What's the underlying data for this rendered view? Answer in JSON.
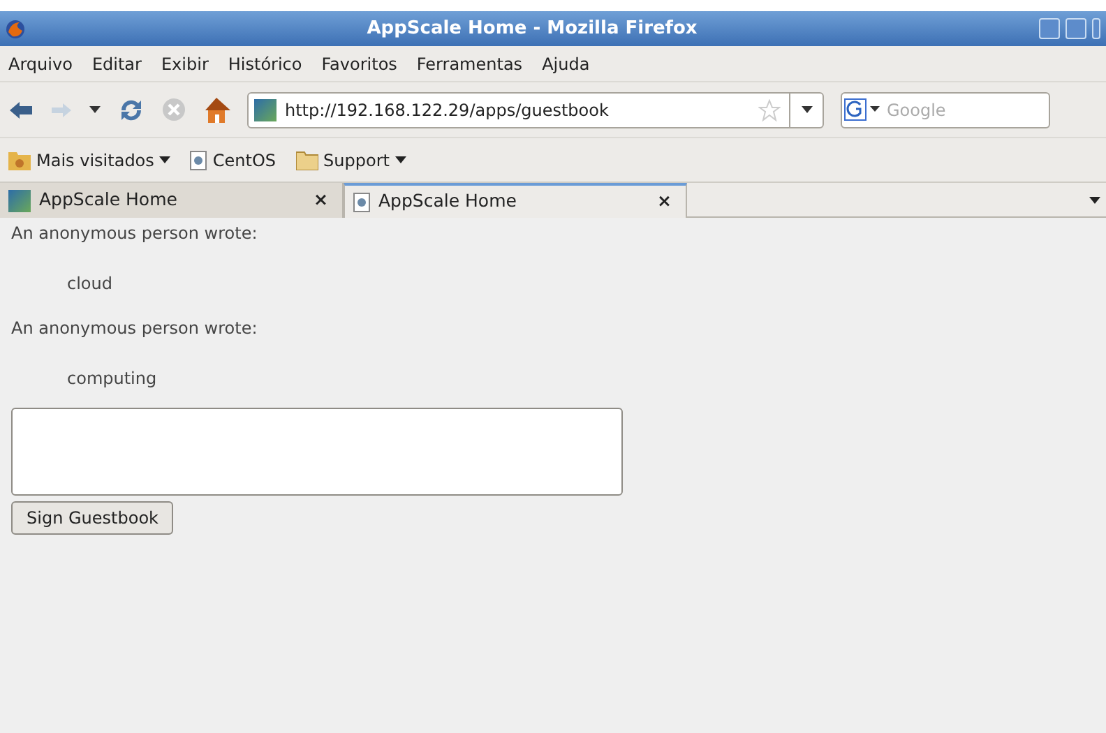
{
  "window": {
    "title": "AppScale Home - Mozilla Firefox"
  },
  "menu": [
    "Arquivo",
    "Editar",
    "Exibir",
    "Histórico",
    "Favoritos",
    "Ferramentas",
    "Ajuda"
  ],
  "address_bar": {
    "value": "http://192.168.122.29/apps/guestbook"
  },
  "search": {
    "placeholder": "Google"
  },
  "bookmarks": [
    {
      "label": "Mais visitados",
      "kind": "smart-folder",
      "dropdown": true
    },
    {
      "label": "CentOS",
      "kind": "page",
      "dropdown": false
    },
    {
      "label": "Support",
      "kind": "folder",
      "dropdown": true
    }
  ],
  "tabs": [
    {
      "label": "AppScale Home",
      "selected": false,
      "kind": "appscale"
    },
    {
      "label": "AppScale Home",
      "selected": true,
      "kind": "page"
    }
  ],
  "close_glyph": "×",
  "entries": [
    {
      "author": "An anonymous person wrote:",
      "message": "cloud"
    },
    {
      "author": "An anonymous person wrote:",
      "message": "computing"
    }
  ],
  "sign_button": "Sign Guestbook"
}
